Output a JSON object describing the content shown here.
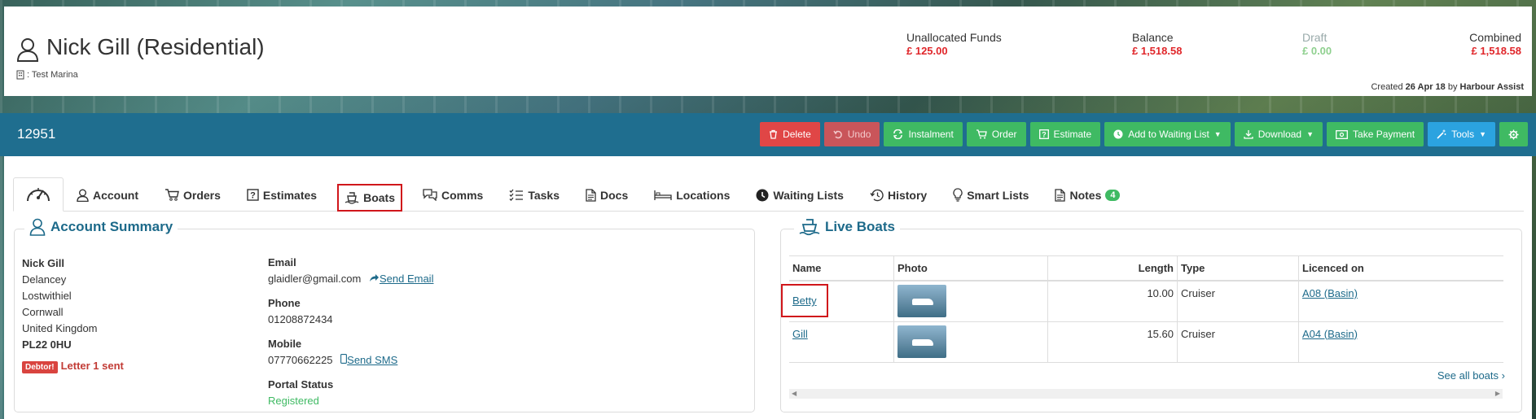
{
  "header": {
    "title": "Nick Gill (Residential)",
    "marina": ": Test Marina",
    "funds": [
      {
        "label": "Unallocated Funds",
        "value": "£ 125.00",
        "color": "#e0262a"
      },
      {
        "label": "Balance",
        "value": "£ 1,518.58",
        "color": "#e0262a"
      },
      {
        "label": "Draft",
        "value": "£ 0.00",
        "color": "#8fd08f"
      },
      {
        "label": "Combined",
        "value": "£ 1,518.58",
        "color": "#e0262a"
      }
    ],
    "created_prefix": "Created",
    "created_date": "26 Apr 18",
    "created_by_prefix": "by",
    "created_by": "Harbour Assist"
  },
  "toolbar": {
    "account_number": "12951",
    "buttons": {
      "delete": "Delete",
      "undo": "Undo",
      "instalment": "Instalment",
      "order": "Order",
      "estimate": "Estimate",
      "waiting_list": "Add to Waiting List",
      "download": "Download",
      "take_payment": "Take Payment",
      "tools": "Tools"
    }
  },
  "tabs": {
    "account": "Account",
    "orders": "Orders",
    "estimates": "Estimates",
    "boats": "Boats",
    "comms": "Comms",
    "tasks": "Tasks",
    "docs": "Docs",
    "locations": "Locations",
    "waiting_lists": "Waiting Lists",
    "history": "History",
    "smart_lists": "Smart Lists",
    "notes": "Notes",
    "notes_count": "4"
  },
  "account_summary": {
    "title": "Account Summary",
    "name": "Nick Gill",
    "address": [
      "Delancey",
      "Lostwithiel",
      "Cornwall",
      "United Kingdom"
    ],
    "postcode": "PL22 0HU",
    "debtor_tag": "Debtor!",
    "debtor_letter": "Letter 1 sent",
    "email_label": "Email",
    "email": "glaidler@gmail.com",
    "send_email": "Send Email",
    "phone_label": "Phone",
    "phone": "01208872434",
    "mobile_label": "Mobile",
    "mobile": "07770662225",
    "send_sms": "Send SMS",
    "portal_label": "Portal Status",
    "portal_status": "Registered"
  },
  "live_boats": {
    "title": "Live Boats",
    "columns": {
      "name": "Name",
      "photo": "Photo",
      "length": "Length",
      "type": "Type",
      "licenced": "Licenced on"
    },
    "rows": [
      {
        "name": "Betty",
        "length": "10.00",
        "type": "Cruiser",
        "licenced": "A08 (Basin)"
      },
      {
        "name": "Gill",
        "length": "15.60",
        "type": "Cruiser",
        "licenced": "A04 (Basin)"
      }
    ],
    "see_all": "See all boats"
  }
}
